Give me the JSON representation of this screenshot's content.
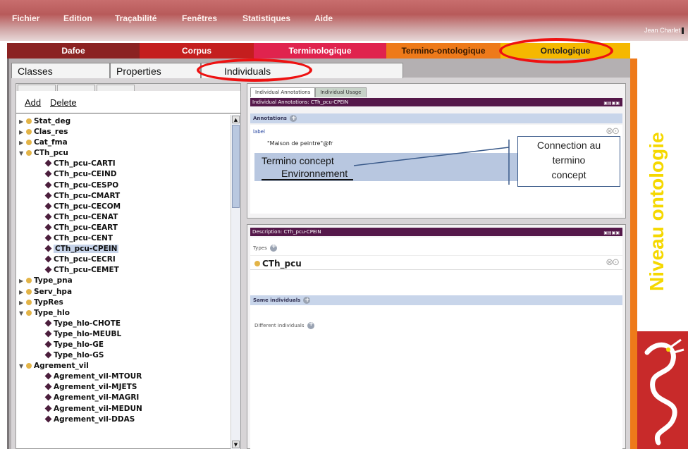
{
  "menu": {
    "items": [
      "Fichier",
      "Edition",
      "Traçabilité",
      "Fenêtres",
      "Statistiques",
      "Aide"
    ],
    "user": "Jean Charlet"
  },
  "top_tabs": [
    "Dafoe",
    "Corpus",
    "Terminologique",
    "Termino-ontologique",
    "Ontologique"
  ],
  "sub_tabs": [
    "Classes",
    "Properties",
    "Individuals"
  ],
  "left_panel": {
    "add": "Add",
    "delete": "Delete",
    "tree": [
      {
        "label": "Stat_deg",
        "kind": "class",
        "level": 0,
        "state": "collapsed"
      },
      {
        "label": "Clas_res",
        "kind": "class",
        "level": 0,
        "state": "collapsed"
      },
      {
        "label": "Cat_fma",
        "kind": "class",
        "level": 0,
        "state": "collapsed"
      },
      {
        "label": "CTh_pcu",
        "kind": "class",
        "level": 0,
        "state": "expanded"
      },
      {
        "label": "CTh_pcu-CARTI",
        "kind": "individual",
        "level": 1
      },
      {
        "label": "CTh_pcu-CEIND",
        "kind": "individual",
        "level": 1
      },
      {
        "label": "CTh_pcu-CESPO",
        "kind": "individual",
        "level": 1
      },
      {
        "label": "CTh_pcu-CMART",
        "kind": "individual",
        "level": 1
      },
      {
        "label": "CTh_pcu-CECOM",
        "kind": "individual",
        "level": 1
      },
      {
        "label": "CTh_pcu-CENAT",
        "kind": "individual",
        "level": 1
      },
      {
        "label": "CTh_pcu-CEART",
        "kind": "individual",
        "level": 1
      },
      {
        "label": "CTh_pcu-CENT",
        "kind": "individual",
        "level": 1
      },
      {
        "label": "CTh_pcu-CPEIN",
        "kind": "individual",
        "level": 1,
        "selected": true
      },
      {
        "label": "CTh_pcu-CECRI",
        "kind": "individual",
        "level": 1
      },
      {
        "label": "CTh_pcu-CEMET",
        "kind": "individual",
        "level": 1
      },
      {
        "label": "Type_pna",
        "kind": "class",
        "level": 0,
        "state": "collapsed"
      },
      {
        "label": "Serv_hpa",
        "kind": "class",
        "level": 0,
        "state": "collapsed"
      },
      {
        "label": "TypRes",
        "kind": "class",
        "level": 0,
        "state": "collapsed"
      },
      {
        "label": "Type_hlo",
        "kind": "class",
        "level": 0,
        "state": "expanded"
      },
      {
        "label": "Type_hlo-CHOTE",
        "kind": "individual",
        "level": 1
      },
      {
        "label": "Type_hlo-MEUBL",
        "kind": "individual",
        "level": 1
      },
      {
        "label": "Type_hlo-GE",
        "kind": "individual",
        "level": 1
      },
      {
        "label": "Type_hlo-GS",
        "kind": "individual",
        "level": 1
      },
      {
        "label": "Agrement_vil",
        "kind": "class",
        "level": 0,
        "state": "expanded"
      },
      {
        "label": "Agrement_vil-MTOUR",
        "kind": "individual",
        "level": 1
      },
      {
        "label": "Agrement_vil-MJETS",
        "kind": "individual",
        "level": 1
      },
      {
        "label": "Agrement_vil-MAGRI",
        "kind": "individual",
        "level": 1
      },
      {
        "label": "Agrement_vil-MEDUN",
        "kind": "individual",
        "level": 1
      },
      {
        "label": "Agrement_vil-DDAS",
        "kind": "individual",
        "level": 1
      }
    ]
  },
  "annotations_panel": {
    "tabs": [
      "Individual Annotations",
      "Individual Usage"
    ],
    "title": "Individual Annotations: CTh_pcu-CPEIN",
    "section": "Annotations",
    "label_tag": "label",
    "label_value": "\"Maison de peintre\"@fr",
    "termino_line1": "Termino concept",
    "termino_line2": "Environnement",
    "callout": [
      "Connection au",
      "termino",
      "concept"
    ]
  },
  "description_panel": {
    "title": "Description: CTh_pcu-CPEIN",
    "types_label": "Types",
    "type_value": "CTh_pcu",
    "same_label": "Same individuals",
    "different_label": "Different individuals"
  },
  "side_banner": "Niveau ontologie",
  "colors": {
    "dafoe": "#8b2222",
    "corpus": "#c41e1e",
    "terminologique": "#e0234e",
    "termino_ontologique": "#ee7a1a",
    "ontologique": "#f5b800",
    "highlight_ellipse": "#e11111",
    "panel_title": "#55184a"
  }
}
